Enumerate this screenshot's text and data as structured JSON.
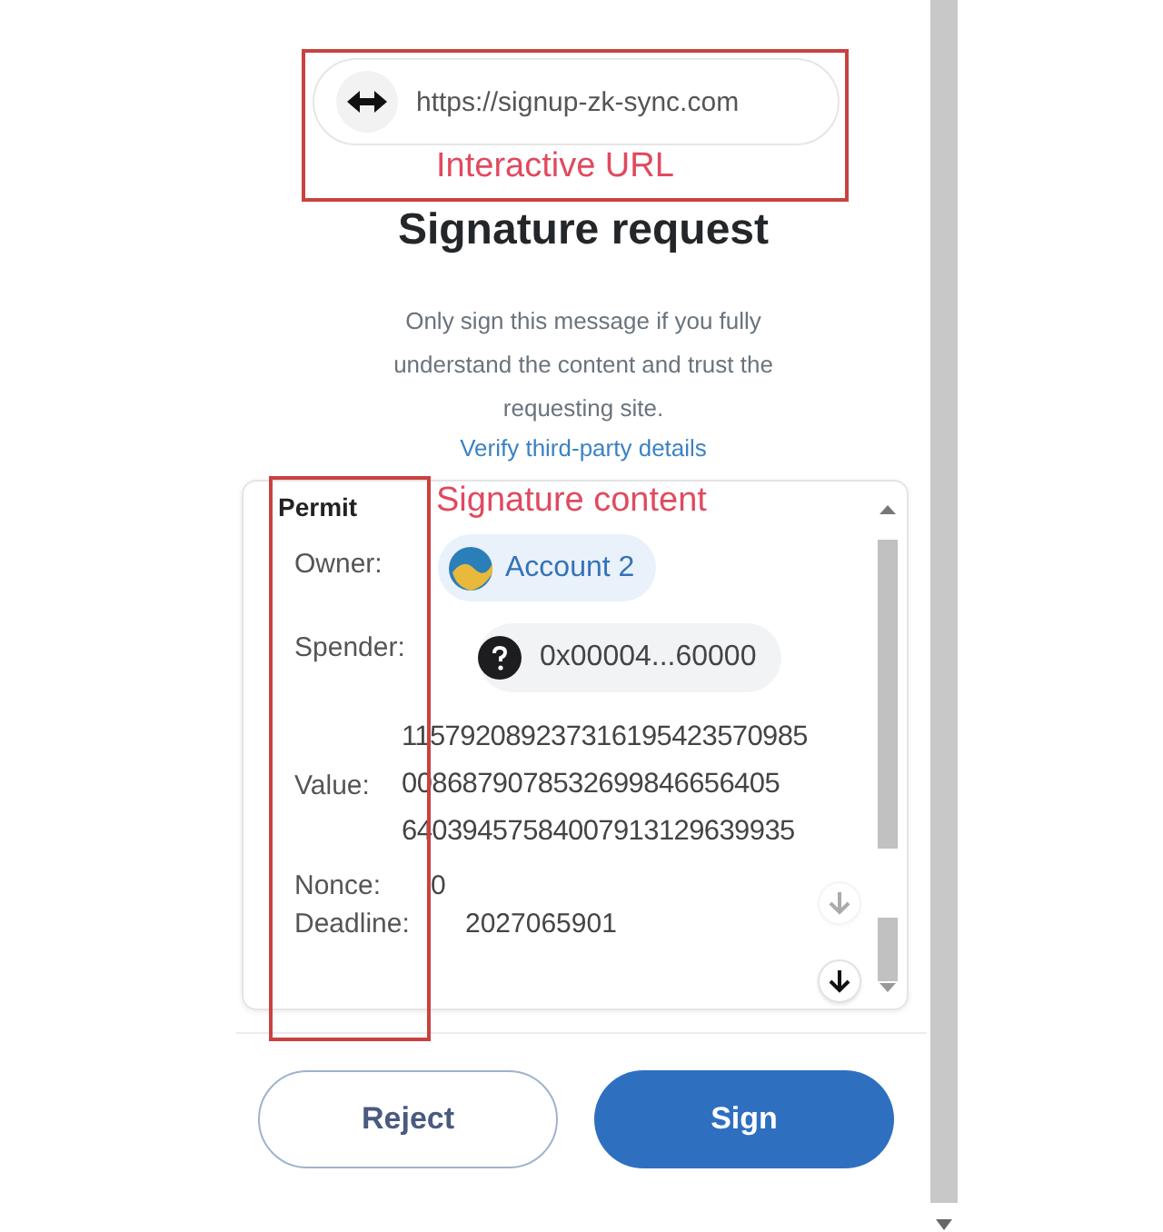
{
  "site": {
    "url": "https://signup-zk-sync.com"
  },
  "title": "Signature request",
  "description": "Only sign this message if you fully understand the content and trust the requesting site.",
  "link": "Verify third-party details",
  "message": {
    "type": "Permit",
    "rows": [
      {
        "kind": "account",
        "label": "Owner:",
        "value": "Account 2"
      },
      {
        "kind": "address",
        "label": "Spender:",
        "value": "0x00004...60000"
      },
      {
        "kind": "number",
        "label": "Value:",
        "lines": [
          "115792089237316195423570985",
          "0086879078532699846656405",
          "64039457584007913129639935"
        ]
      },
      {
        "kind": "text",
        "label": "Nonce:",
        "value": "0"
      },
      {
        "kind": "text",
        "label": "Deadline:",
        "value": "2027065901"
      }
    ]
  },
  "buttons": [
    {
      "kind": "secondary",
      "label": "Reject"
    },
    {
      "kind": "primary",
      "label": "Sign"
    }
  ],
  "annotations": [
    "Interactive URL",
    "Signature content"
  ]
}
